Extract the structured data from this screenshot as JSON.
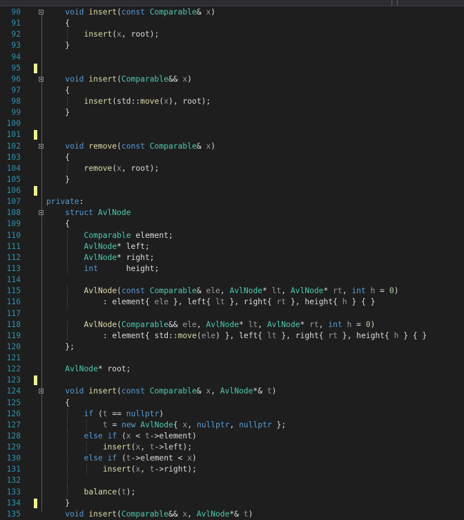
{
  "editor": {
    "language": "C++",
    "colors": {
      "background": "#1e1e1e",
      "line_number": "#2b91af",
      "keyword": "#569cd6",
      "type": "#4ec9b0",
      "function": "#dcdcaa",
      "parameter": "#9a9a9a",
      "number": "#b5cea8",
      "text": "#dcdcdc",
      "change_marker": "#efef91"
    },
    "lines": [
      {
        "n": "90",
        "tokens": [
          [
            "kw",
            "void"
          ],
          [
            "tx",
            " "
          ],
          [
            "fn",
            "insert"
          ],
          [
            "tx",
            "("
          ],
          [
            "kw",
            "const"
          ],
          [
            "tx",
            " "
          ],
          [
            "ty",
            "Comparable"
          ],
          [
            "tx",
            "& "
          ],
          [
            "pr",
            "x"
          ],
          [
            "tx",
            ")"
          ]
        ]
      },
      {
        "n": "91",
        "tokens": [
          [
            "tx",
            "{"
          ]
        ]
      },
      {
        "n": "92",
        "tokens": [
          [
            "fn",
            "insert"
          ],
          [
            "tx",
            "("
          ],
          [
            "pr",
            "x"
          ],
          [
            "tx",
            ", root);"
          ]
        ]
      },
      {
        "n": "93",
        "tokens": [
          [
            "tx",
            "}"
          ]
        ]
      },
      {
        "n": "94",
        "tokens": []
      },
      {
        "n": "95",
        "tokens": []
      },
      {
        "n": "96",
        "tokens": [
          [
            "kw",
            "void"
          ],
          [
            "tx",
            " "
          ],
          [
            "fn",
            "insert"
          ],
          [
            "tx",
            "("
          ],
          [
            "ty",
            "Comparable"
          ],
          [
            "tx",
            "&& "
          ],
          [
            "pr",
            "x"
          ],
          [
            "tx",
            ")"
          ]
        ]
      },
      {
        "n": "97",
        "tokens": [
          [
            "tx",
            "{"
          ]
        ]
      },
      {
        "n": "98",
        "tokens": [
          [
            "fn",
            "insert"
          ],
          [
            "tx",
            "(std::"
          ],
          [
            "fn",
            "move"
          ],
          [
            "tx",
            "("
          ],
          [
            "pr",
            "x"
          ],
          [
            "tx",
            "), root);"
          ]
        ]
      },
      {
        "n": "99",
        "tokens": [
          [
            "tx",
            "}"
          ]
        ]
      },
      {
        "n": "100",
        "tokens": []
      },
      {
        "n": "101",
        "tokens": []
      },
      {
        "n": "102",
        "tokens": [
          [
            "kw",
            "void"
          ],
          [
            "tx",
            " "
          ],
          [
            "fn",
            "remove"
          ],
          [
            "tx",
            "("
          ],
          [
            "kw",
            "const"
          ],
          [
            "tx",
            " "
          ],
          [
            "ty",
            "Comparable"
          ],
          [
            "tx",
            "& "
          ],
          [
            "pr",
            "x"
          ],
          [
            "tx",
            ")"
          ]
        ]
      },
      {
        "n": "103",
        "tokens": [
          [
            "tx",
            "{"
          ]
        ]
      },
      {
        "n": "104",
        "tokens": [
          [
            "fn",
            "remove"
          ],
          [
            "tx",
            "("
          ],
          [
            "pr",
            "x"
          ],
          [
            "tx",
            ", root);"
          ]
        ]
      },
      {
        "n": "105",
        "tokens": [
          [
            "tx",
            "}"
          ]
        ]
      },
      {
        "n": "106",
        "tokens": []
      },
      {
        "n": "107",
        "tokens": [
          [
            "kw",
            "private"
          ],
          [
            "tx",
            ":"
          ]
        ]
      },
      {
        "n": "108",
        "tokens": [
          [
            "kw",
            "struct"
          ],
          [
            "tx",
            " "
          ],
          [
            "ty",
            "AvlNode"
          ]
        ]
      },
      {
        "n": "109",
        "tokens": [
          [
            "tx",
            "{"
          ]
        ]
      },
      {
        "n": "110",
        "tokens": [
          [
            "ty",
            "Comparable"
          ],
          [
            "tx",
            " element;"
          ]
        ]
      },
      {
        "n": "111",
        "tokens": [
          [
            "ty",
            "AvlNode"
          ],
          [
            "tx",
            "* left;"
          ]
        ]
      },
      {
        "n": "112",
        "tokens": [
          [
            "ty",
            "AvlNode"
          ],
          [
            "tx",
            "* right;"
          ]
        ]
      },
      {
        "n": "113",
        "tokens": [
          [
            "kw",
            "int"
          ],
          [
            "tx",
            "      height;"
          ]
        ]
      },
      {
        "n": "114",
        "tokens": []
      },
      {
        "n": "115",
        "tokens": [
          [
            "fn",
            "AvlNode"
          ],
          [
            "tx",
            "("
          ],
          [
            "kw",
            "const"
          ],
          [
            "tx",
            " "
          ],
          [
            "ty",
            "Comparable"
          ],
          [
            "tx",
            "& "
          ],
          [
            "pr",
            "ele"
          ],
          [
            "tx",
            ", "
          ],
          [
            "ty",
            "AvlNode"
          ],
          [
            "tx",
            "* "
          ],
          [
            "pr",
            "lt"
          ],
          [
            "tx",
            ", "
          ],
          [
            "ty",
            "AvlNode"
          ],
          [
            "tx",
            "* "
          ],
          [
            "pr",
            "rt"
          ],
          [
            "tx",
            ", "
          ],
          [
            "kw",
            "int"
          ],
          [
            "tx",
            " "
          ],
          [
            "pr",
            "h"
          ],
          [
            "tx",
            " = "
          ],
          [
            "nm",
            "0"
          ],
          [
            "tx",
            ")"
          ]
        ]
      },
      {
        "n": "116",
        "tokens": [
          [
            "tx",
            ": element{ "
          ],
          [
            "pr",
            "ele"
          ],
          [
            "tx",
            " }, left{ "
          ],
          [
            "pr",
            "lt"
          ],
          [
            "tx",
            " }, right{ "
          ],
          [
            "pr",
            "rt"
          ],
          [
            "tx",
            " }, height{ "
          ],
          [
            "pr",
            "h"
          ],
          [
            "tx",
            " } { }"
          ]
        ]
      },
      {
        "n": "117",
        "tokens": []
      },
      {
        "n": "118",
        "tokens": [
          [
            "fn",
            "AvlNode"
          ],
          [
            "tx",
            "("
          ],
          [
            "ty",
            "Comparable"
          ],
          [
            "tx",
            "&& "
          ],
          [
            "pr",
            "ele"
          ],
          [
            "tx",
            ", "
          ],
          [
            "ty",
            "AvlNode"
          ],
          [
            "tx",
            "* "
          ],
          [
            "pr",
            "lt"
          ],
          [
            "tx",
            ", "
          ],
          [
            "ty",
            "AvlNode"
          ],
          [
            "tx",
            "* "
          ],
          [
            "pr",
            "rt"
          ],
          [
            "tx",
            ", "
          ],
          [
            "kw",
            "int"
          ],
          [
            "tx",
            " "
          ],
          [
            "pr",
            "h"
          ],
          [
            "tx",
            " = "
          ],
          [
            "nm",
            "0"
          ],
          [
            "tx",
            ")"
          ]
        ]
      },
      {
        "n": "119",
        "tokens": [
          [
            "tx",
            ": element{ std::"
          ],
          [
            "fn",
            "move"
          ],
          [
            "tx",
            "("
          ],
          [
            "pr",
            "ele"
          ],
          [
            "tx",
            ") }, left{ "
          ],
          [
            "pr",
            "lt"
          ],
          [
            "tx",
            " }, right{ "
          ],
          [
            "pr",
            "rt"
          ],
          [
            "tx",
            " }, height{ "
          ],
          [
            "pr",
            "h"
          ],
          [
            "tx",
            " } { }"
          ]
        ]
      },
      {
        "n": "120",
        "tokens": [
          [
            "tx",
            "};"
          ]
        ]
      },
      {
        "n": "121",
        "tokens": []
      },
      {
        "n": "122",
        "tokens": [
          [
            "ty",
            "AvlNode"
          ],
          [
            "tx",
            "* root;"
          ]
        ]
      },
      {
        "n": "123",
        "tokens": []
      },
      {
        "n": "124",
        "tokens": [
          [
            "kw",
            "void"
          ],
          [
            "tx",
            " "
          ],
          [
            "fn",
            "insert"
          ],
          [
            "tx",
            "("
          ],
          [
            "kw",
            "const"
          ],
          [
            "tx",
            " "
          ],
          [
            "ty",
            "Comparable"
          ],
          [
            "tx",
            "& "
          ],
          [
            "pr",
            "x"
          ],
          [
            "tx",
            ", "
          ],
          [
            "ty",
            "AvlNode"
          ],
          [
            "tx",
            "*& "
          ],
          [
            "pr",
            "t"
          ],
          [
            "tx",
            ")"
          ]
        ]
      },
      {
        "n": "125",
        "tokens": [
          [
            "tx",
            "{"
          ]
        ]
      },
      {
        "n": "126",
        "tokens": [
          [
            "kw",
            "if"
          ],
          [
            "tx",
            " ("
          ],
          [
            "pr",
            "t"
          ],
          [
            "tx",
            " == "
          ],
          [
            "kw",
            "nullptr"
          ],
          [
            "tx",
            ")"
          ]
        ]
      },
      {
        "n": "127",
        "tokens": [
          [
            "pr",
            "t"
          ],
          [
            "tx",
            " = "
          ],
          [
            "kw",
            "new"
          ],
          [
            "tx",
            " "
          ],
          [
            "ty",
            "AvlNode"
          ],
          [
            "tx",
            "{ "
          ],
          [
            "pr",
            "x"
          ],
          [
            "tx",
            ", "
          ],
          [
            "kw",
            "nullptr"
          ],
          [
            "tx",
            ", "
          ],
          [
            "kw",
            "nullptr"
          ],
          [
            "tx",
            " };"
          ]
        ]
      },
      {
        "n": "128",
        "tokens": [
          [
            "kw",
            "else"
          ],
          [
            "tx",
            " "
          ],
          [
            "kw",
            "if"
          ],
          [
            "tx",
            " ("
          ],
          [
            "pr",
            "x"
          ],
          [
            "tx",
            " < "
          ],
          [
            "pr",
            "t"
          ],
          [
            "tx",
            "->element)"
          ]
        ]
      },
      {
        "n": "129",
        "tokens": [
          [
            "fn",
            "insert"
          ],
          [
            "tx",
            "("
          ],
          [
            "pr",
            "x"
          ],
          [
            "tx",
            ", "
          ],
          [
            "pr",
            "t"
          ],
          [
            "tx",
            "->left);"
          ]
        ]
      },
      {
        "n": "130",
        "tokens": [
          [
            "kw",
            "else"
          ],
          [
            "tx",
            " "
          ],
          [
            "kw",
            "if"
          ],
          [
            "tx",
            " ("
          ],
          [
            "pr",
            "t"
          ],
          [
            "tx",
            "->element < "
          ],
          [
            "pr",
            "x"
          ],
          [
            "tx",
            ")"
          ]
        ]
      },
      {
        "n": "131",
        "tokens": [
          [
            "fn",
            "insert"
          ],
          [
            "tx",
            "("
          ],
          [
            "pr",
            "x"
          ],
          [
            "tx",
            ", "
          ],
          [
            "pr",
            "t"
          ],
          [
            "tx",
            "->right);"
          ]
        ]
      },
      {
        "n": "132",
        "tokens": []
      },
      {
        "n": "133",
        "tokens": [
          [
            "fn",
            "balance"
          ],
          [
            "tx",
            "("
          ],
          [
            "pr",
            "t"
          ],
          [
            "tx",
            ");"
          ]
        ]
      },
      {
        "n": "134",
        "tokens": [
          [
            "tx",
            "}"
          ]
        ]
      },
      {
        "n": "135",
        "tokens": [
          [
            "kw",
            "void"
          ],
          [
            "tx",
            " "
          ],
          [
            "fn",
            "insert"
          ],
          [
            "tx",
            "("
          ],
          [
            "ty",
            "Comparable"
          ],
          [
            "tx",
            "&& "
          ],
          [
            "pr",
            "x"
          ],
          [
            "tx",
            ", "
          ],
          [
            "ty",
            "AvlNode"
          ],
          [
            "tx",
            "*& "
          ],
          [
            "pr",
            "t"
          ],
          [
            "tx",
            ")"
          ]
        ]
      }
    ]
  }
}
